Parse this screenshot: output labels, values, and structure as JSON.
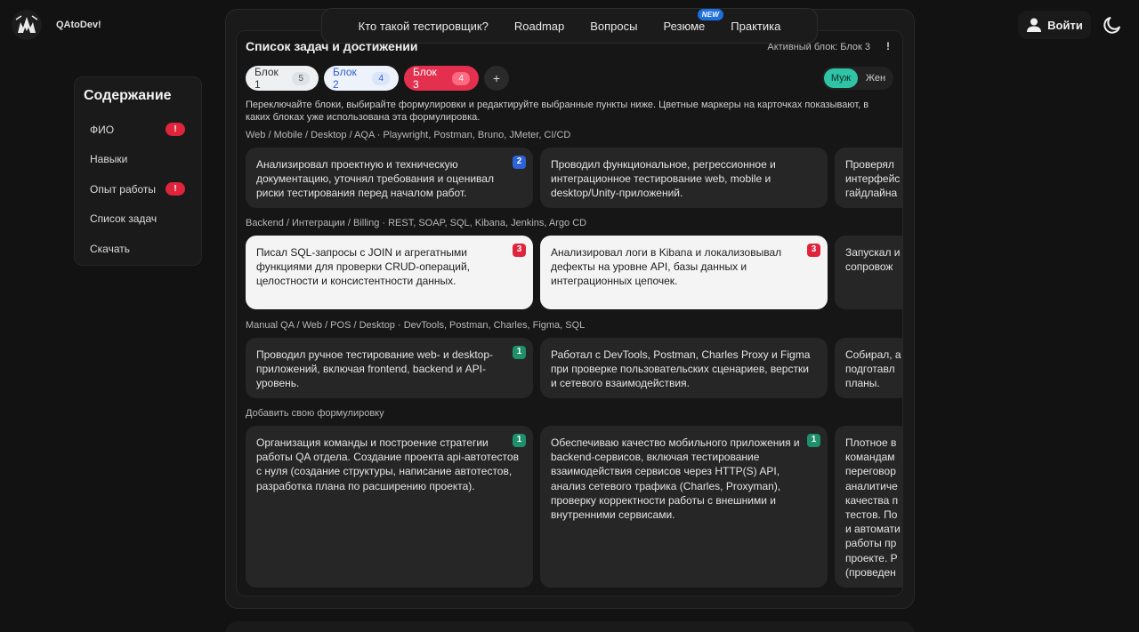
{
  "header": {
    "brand": "QAtoDev!",
    "nav": [
      "Кто такой тестировщик?",
      "Roadmap",
      "Вопросы",
      "Резюме",
      "Практика"
    ],
    "new_badge": "NEW",
    "login_label": "Войти"
  },
  "sidebar": {
    "title": "Содержание",
    "items": [
      {
        "label": "ФИО",
        "badge": "!"
      },
      {
        "label": "Навыки",
        "badge": null
      },
      {
        "label": "Опыт работы",
        "badge": "!"
      },
      {
        "label": "Список задач",
        "badge": null
      },
      {
        "label": "Скачать",
        "badge": null
      }
    ]
  },
  "panel": {
    "title": "Список задач и достижений",
    "active_block": "Активный блок: Блок 3",
    "active_mark": "!",
    "tabs": [
      {
        "label": "Блок 1",
        "count": "5"
      },
      {
        "label": "Блок 2",
        "count": "4"
      },
      {
        "label": "Блок 3",
        "count": "4"
      }
    ],
    "add_tab": "+",
    "gender": {
      "male": "Муж",
      "female": "Жен"
    },
    "hint": "Переключайте блоки, выбирайте формулировки и редактируйте выбранные пункты ниже. Цветные маркеры на карточках показывают, в каких блоках уже использована эта формулировка.",
    "sections": [
      {
        "label": "Web / Mobile / Desktop / AQA · Playwright, Postman, Bruno, JMeter, CI/CD",
        "cards": [
          {
            "text": "Анализировал проектную и техническую документацию, уточнял требования и оценивал риски тестирования перед началом работ.",
            "marker": "2"
          },
          {
            "text": "Проводил функциональное, регрессионное и интеграционное тестирование web, mobile и desktop/Unity-приложений.",
            "marker": null
          },
          {
            "text": "Проверял интерфейс гайдлайна",
            "marker": null
          }
        ]
      },
      {
        "label": "Backend / Интеграции / Billing · REST, SOAP, SQL, Kibana, Jenkins, Argo CD",
        "cards": [
          {
            "text": "Писал SQL-запросы с JOIN и агрегатными функциями для проверки CRUD-операций, целостности и консистентности данных.",
            "marker": "3"
          },
          {
            "text": "Анализировал логи в Kibana и локализовывал дефекты на уровне API, базы данных и интеграционных цепочек.",
            "marker": "3"
          },
          {
            "text": "Запускал и сопровож",
            "marker": null
          }
        ]
      },
      {
        "label": "Manual QA / Web / POS / Desktop · DevTools, Postman, Charles, Figma, SQL",
        "cards": [
          {
            "text": "Проводил ручное тестирование web- и desktop-приложений, включая frontend, backend и API-уровень.",
            "marker": "1"
          },
          {
            "text": "Работал с DevTools, Postman, Charles Proxy и Figma при проверке пользовательских сценариев, верстки и сетевого взаимодействия.",
            "marker": null
          },
          {
            "text": "Собирал, а подготавл планы.",
            "marker": null
          }
        ]
      },
      {
        "label": "Добавить свою формулировку",
        "cards": [
          {
            "text": "Организация команды и построение стратегии работы QA отдела. Создание проекта api-автотестов с нуля (создание структуры, написание автотестов, разработка плана по расширению проекта).",
            "marker": "1"
          },
          {
            "text": "Обеспечиваю качество мобильного приложения и backend-сервисов, включая тестирование взаимодействия сервисов через HTTP(S) API, анализ сетевого трафика (Charles, Proxyman), проверку корректности работы с внешними и внутренними сервисами.",
            "marker": "1"
          },
          {
            "text": "Плотное в командам переговор аналитиче качества п тестов. По и автомати работы пр проекте. Р (проведен",
            "marker": null
          }
        ]
      }
    ]
  }
}
